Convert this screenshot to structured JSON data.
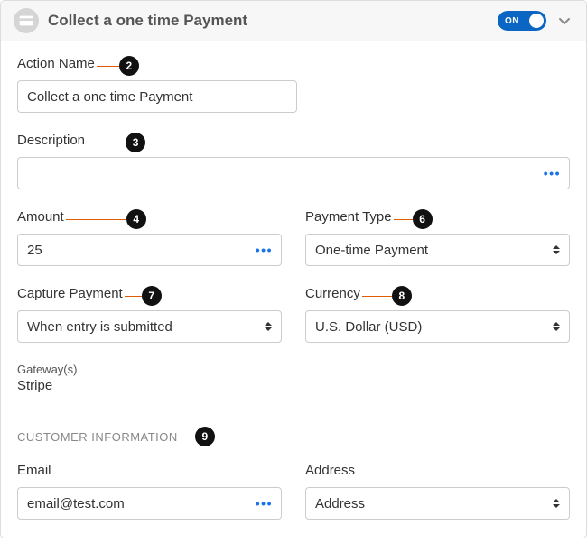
{
  "header": {
    "title": "Collect a one time Payment",
    "toggle_state": "ON"
  },
  "annotations": {
    "action_name": "2",
    "description": "3",
    "amount": "4",
    "payment_type": "6",
    "capture_payment": "7",
    "currency": "8",
    "customer_info": "9"
  },
  "fields": {
    "action_name": {
      "label": "Action Name",
      "value": "Collect a one time Payment"
    },
    "description": {
      "label": "Description",
      "value": ""
    },
    "amount": {
      "label": "Amount",
      "value": "25"
    },
    "payment_type": {
      "label": "Payment Type",
      "value": "One-time Payment"
    },
    "capture_payment": {
      "label": "Capture Payment",
      "value": "When entry is submitted"
    },
    "currency": {
      "label": "Currency",
      "value": "U.S. Dollar (USD)"
    },
    "gateways": {
      "label": "Gateway(s)",
      "value": "Stripe"
    },
    "customer_section": "CUSTOMER INFORMATION",
    "email": {
      "label": "Email",
      "value": "email@test.com"
    },
    "address": {
      "label": "Address",
      "value": "Address"
    }
  },
  "misc": {
    "dots": "•••"
  }
}
